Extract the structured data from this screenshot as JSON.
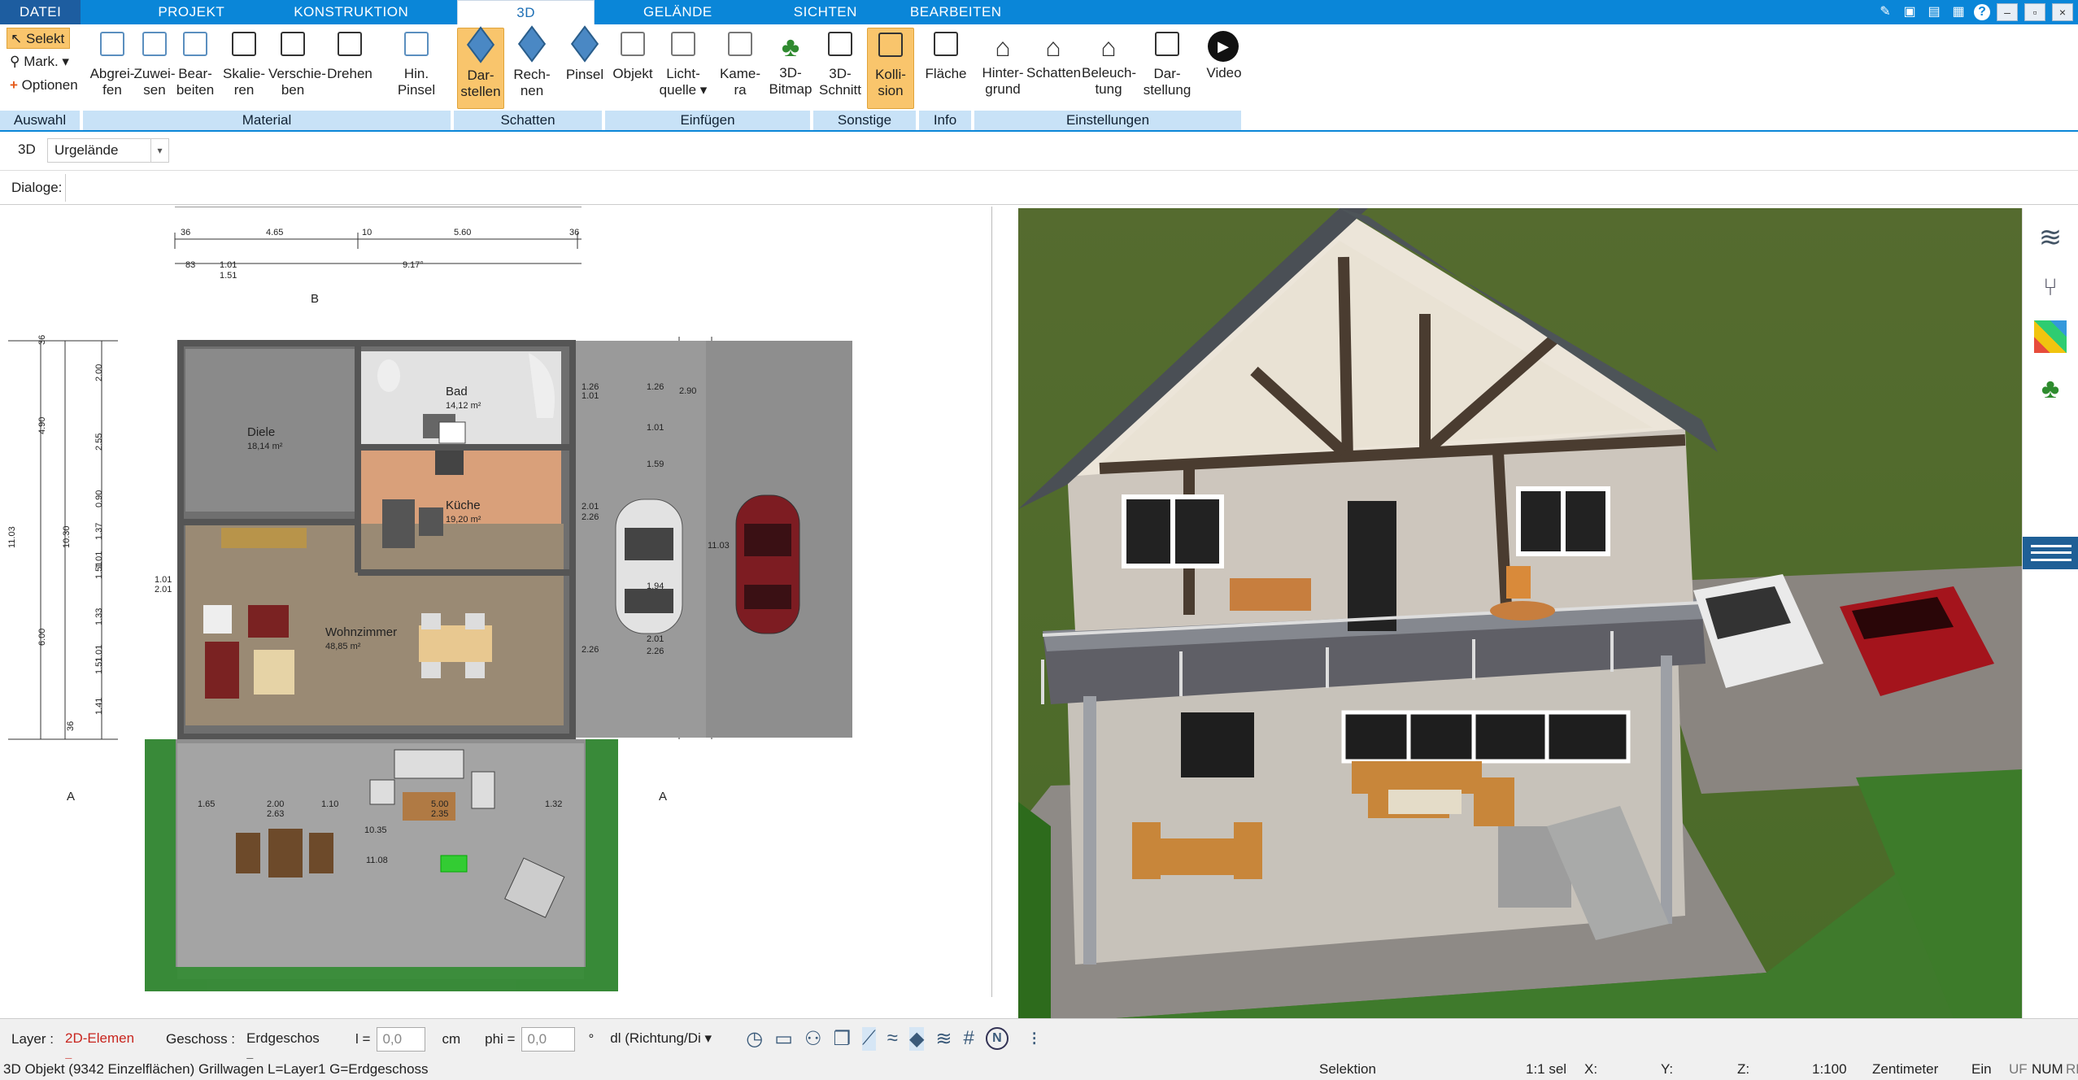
{
  "tabs": [
    "DATEI",
    "PROJEKT",
    "KONSTRUKTION",
    "3D",
    "GELÄNDE",
    "SICHTEN",
    "BEARBEITEN"
  ],
  "active_tab": "3D",
  "ribbon": {
    "auswahl": {
      "label": "Auswahl",
      "items": [
        "Selekt",
        "Mark.",
        "Optionen"
      ]
    },
    "material": {
      "label": "Material",
      "buttons": [
        [
          "Abgrei-",
          "fen"
        ],
        [
          "Zuwei-",
          "sen"
        ],
        [
          "Bear-",
          "beiten"
        ],
        [
          "Skalie-",
          "ren"
        ],
        [
          "Verschie-",
          "ben"
        ],
        [
          "Drehen",
          ""
        ],
        [
          "Hin.",
          "Pinsel"
        ]
      ]
    },
    "schatten": {
      "label": "Schatten",
      "buttons": [
        [
          "Dar-",
          "stellen"
        ],
        [
          "Rech-",
          "nen"
        ],
        [
          "Pinsel",
          ""
        ]
      ]
    },
    "einfuegen": {
      "label": "Einfügen",
      "buttons": [
        [
          "Objekt",
          ""
        ],
        [
          "Licht-",
          "quelle ▾"
        ],
        [
          "Kame-",
          "ra"
        ],
        [
          "3D-",
          "Bitmap"
        ]
      ]
    },
    "sonstige": {
      "label": "Sonstige",
      "buttons": [
        [
          "3D-",
          "Schnitt"
        ],
        [
          "Kolli-",
          "sion"
        ]
      ]
    },
    "info": {
      "label": "Info",
      "buttons": [
        [
          "Fläche",
          ""
        ]
      ]
    },
    "einstellungen": {
      "label": "Einstellungen",
      "buttons": [
        [
          "Hinter-",
          "grund"
        ],
        [
          "Schatten",
          ""
        ],
        [
          "Beleuch-",
          "tung"
        ],
        [
          "Dar-",
          "stellung"
        ],
        [
          "Video",
          ""
        ]
      ]
    }
  },
  "subbar": {
    "mode": "3D",
    "dropdown": "Urgelände"
  },
  "dialoge_label": "Dialoge:",
  "plan": {
    "rooms": [
      {
        "name": "Bad",
        "area": "14,12 m²"
      },
      {
        "name": "Diele",
        "area": "18,14 m²"
      },
      {
        "name": "Küche",
        "area": "19,20 m²"
      },
      {
        "name": "Wohnzimmer",
        "area": "48,85 m²"
      }
    ],
    "top_dims": [
      "4.65",
      "5.60",
      "9.17°",
      "1.01",
      "1.51",
      "36",
      "36",
      "83",
      "10"
    ],
    "side_dims": [
      "4.90",
      "10.30",
      "11.03",
      "6.00",
      "2.00",
      "2.55",
      "0.90",
      "1.37",
      "1.01",
      "1.51",
      "1.33",
      "1.01",
      "1.51",
      "1.41",
      "36",
      "36"
    ],
    "right_dims": [
      "1.26",
      "1.01",
      "2.01",
      "2.26",
      "1.01",
      "2.01",
      "2.26",
      "1.26",
      "1.01",
      "2.01",
      "2.26",
      "1.59",
      "1.94",
      "11.03",
      "2.90"
    ],
    "terrace_dims": [
      "1.65",
      "2.00",
      "2.63",
      "1.10",
      "5.00",
      "2.35",
      "1.32",
      "10.35",
      "11.08"
    ],
    "section_marks": [
      "A",
      "A",
      "B"
    ]
  },
  "statusbar": {
    "layer_label": "Layer :",
    "layer_value": "2D-Elemen",
    "geschoss_label": "Geschoss :",
    "geschoss_value": "Erdgeschos",
    "l_label": "l =",
    "l_value": "0,0",
    "l_unit": "cm",
    "phi_label": "phi =",
    "phi_value": "0,0",
    "phi_unit": "°",
    "dl_value": "dl (Richtung/Di"
  },
  "infobar": {
    "object": "3D Objekt (9342 Einzelflächen) Grillwagen L=Layer1 G=Erdgeschoss",
    "mode": "Selektion",
    "sel": "1:1 sel",
    "x": "X:",
    "y": "Y:",
    "z": "Z:",
    "scale": "1:100",
    "unit": "Zentimeter",
    "ein": "Ein",
    "uf": "UF",
    "num": "NUM",
    "rf": "RF"
  }
}
